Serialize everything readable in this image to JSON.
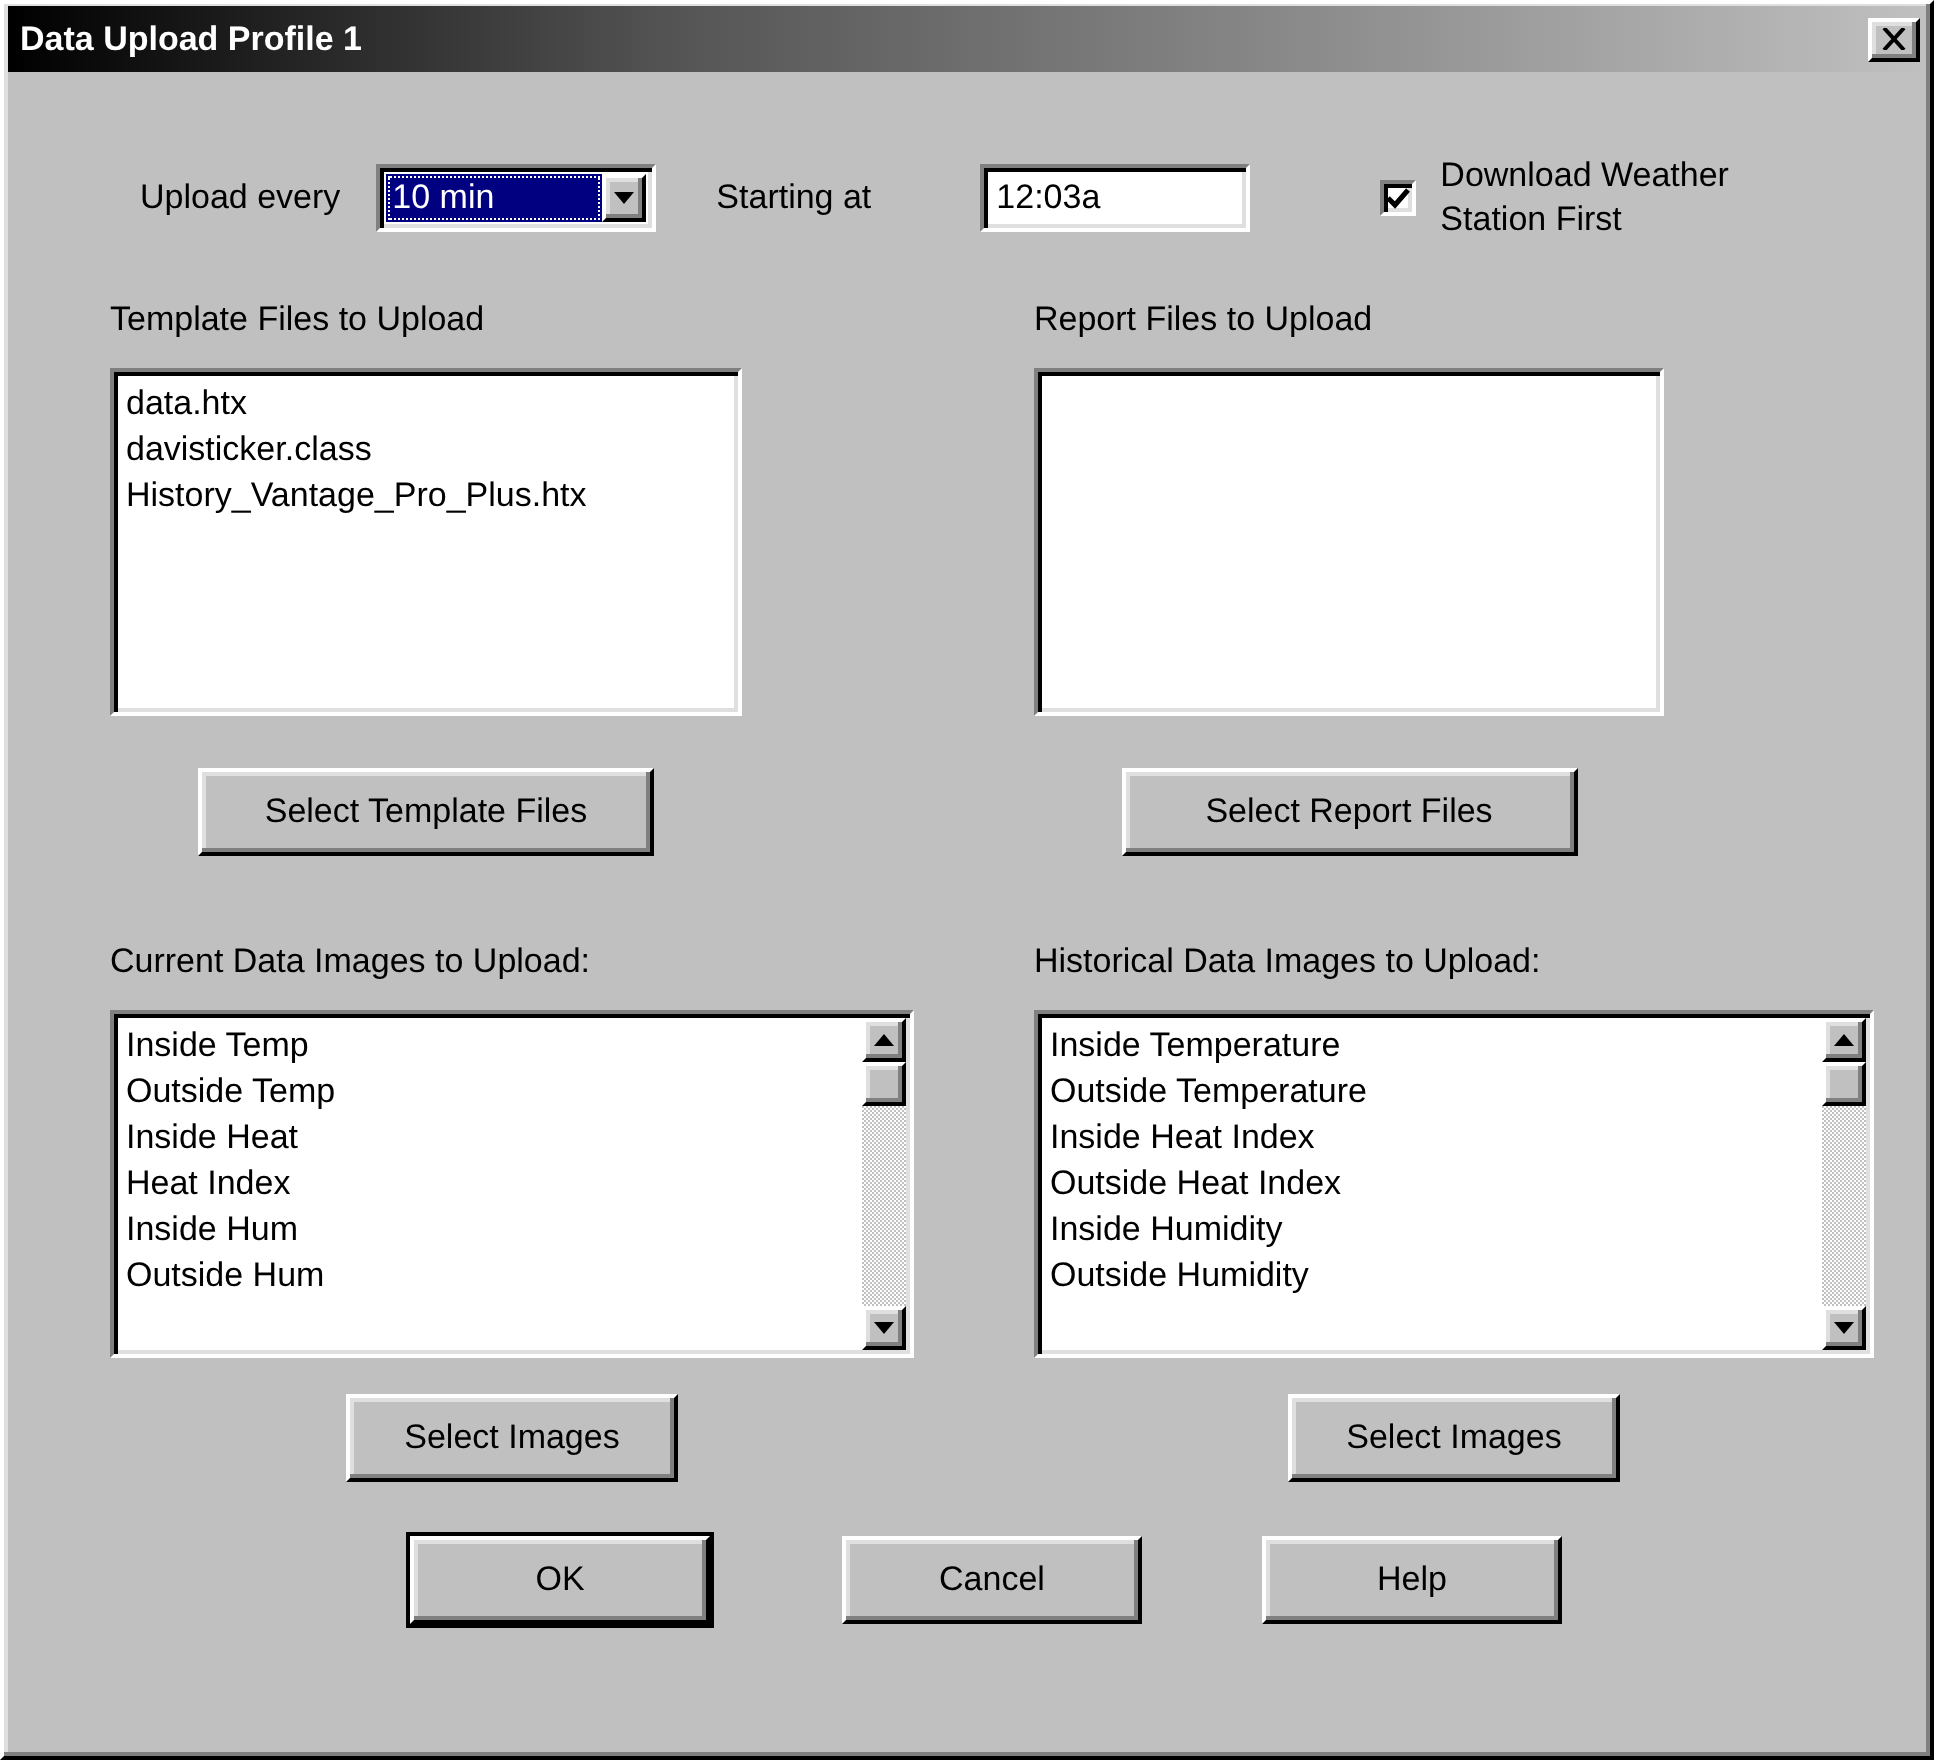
{
  "window": {
    "title": "Data Upload Profile 1"
  },
  "upload_every": {
    "label": "Upload every",
    "value": "10 min",
    "focused": true
  },
  "starting_at": {
    "label": "Starting at",
    "value": "12:03a"
  },
  "download_first": {
    "label": "Download Weather Station First",
    "checked": true
  },
  "template_files": {
    "label": "Template Files to Upload",
    "items": [
      "data.htx",
      "davisticker.class",
      "History_Vantage_Pro_Plus.htx"
    ],
    "button": "Select Template Files"
  },
  "report_files": {
    "label": "Report Files to Upload",
    "button": "Select Report Files"
  },
  "current_images": {
    "label": "Current Data Images to Upload:",
    "items": [
      "Inside Temp",
      "Outside Temp",
      "Inside Heat",
      "Heat Index",
      "Inside Hum",
      "Outside Hum"
    ],
    "button": "Select Images"
  },
  "historical_images": {
    "label": "Historical Data Images to Upload:",
    "items": [
      "Inside Temperature",
      "Outside Temperature",
      "Inside Heat Index",
      "Outside Heat Index",
      "Inside Humidity",
      "Outside Humidity"
    ],
    "button": "Select Images"
  },
  "buttons": [
    {
      "label": "OK",
      "default": true
    },
    {
      "label": "Cancel",
      "default": false
    },
    {
      "label": "Help",
      "default": false
    }
  ]
}
